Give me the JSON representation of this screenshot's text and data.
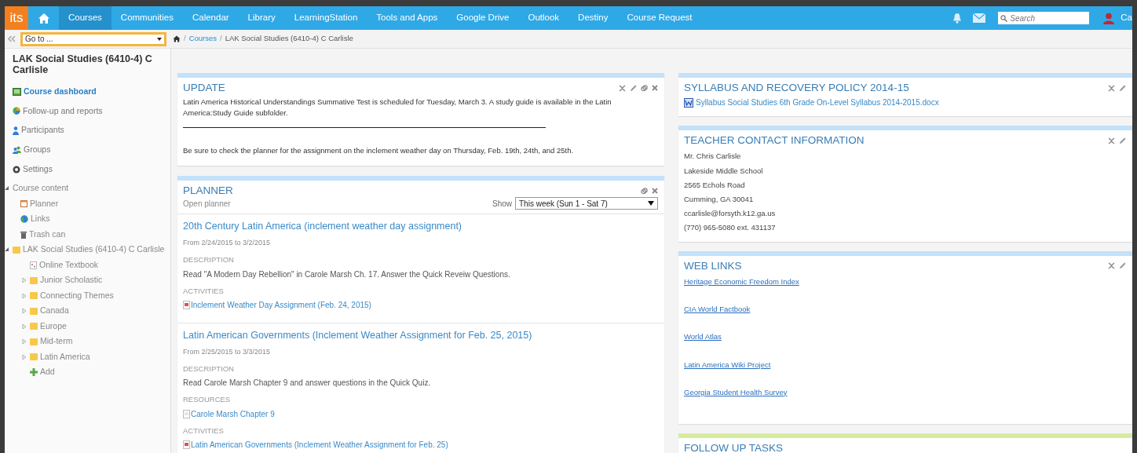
{
  "topnav": {
    "logo": "its",
    "items": [
      {
        "label": "Courses",
        "selected": true
      },
      {
        "label": "Communities",
        "selected": false
      },
      {
        "label": "Calendar",
        "selected": false
      },
      {
        "label": "Library",
        "selected": false
      },
      {
        "label": "LearningStation",
        "selected": false
      },
      {
        "label": "Tools and Apps",
        "selected": false
      },
      {
        "label": "Google Drive",
        "selected": false
      },
      {
        "label": "Outlook",
        "selected": false
      },
      {
        "label": "Destiny",
        "selected": false
      },
      {
        "label": "Course Request",
        "selected": false
      }
    ],
    "search": {
      "placeholder": "Search"
    },
    "user": "Ca"
  },
  "goto": {
    "placeholder": "Go to ..."
  },
  "breadcrumb": {
    "separator": "/",
    "items": [
      "Courses",
      "LAK Social Studies (6410-4) C Carlisle"
    ]
  },
  "sidebar": {
    "title": "LAK Social Studies (6410-4) C Carlisle",
    "nav": [
      {
        "label": "Course dashboard",
        "kind": "dashboard",
        "selected": true
      },
      {
        "label": "Follow-up and reports",
        "kind": "reports",
        "selected": false
      },
      {
        "label": "Participants",
        "kind": "participants",
        "selected": false
      },
      {
        "label": "Groups",
        "kind": "groups",
        "selected": false
      },
      {
        "label": "Settings",
        "kind": "settings",
        "selected": false
      }
    ],
    "tree": [
      {
        "label": "Course content",
        "kind": "section",
        "expanded": true,
        "children": [
          {
            "label": "Planner",
            "kind": "planner"
          },
          {
            "label": "Links",
            "kind": "links"
          },
          {
            "label": "Trash can",
            "kind": "trash"
          }
        ]
      },
      {
        "label": "LAK Social Studies (6410-4) C Carlisle",
        "kind": "folder",
        "expanded": true,
        "children": [
          {
            "label": "Online Textbook",
            "kind": "file"
          },
          {
            "label": "Junior Scholastic",
            "kind": "folder",
            "expanded": false
          },
          {
            "label": "Connecting Themes",
            "kind": "folder",
            "expanded": false
          },
          {
            "label": "Canada",
            "kind": "folder",
            "expanded": false
          },
          {
            "label": "Europe",
            "kind": "folder",
            "expanded": false
          },
          {
            "label": "Mid-term",
            "kind": "folder",
            "expanded": false
          },
          {
            "label": "Latin America",
            "kind": "folder",
            "expanded": false
          },
          {
            "label": "Add",
            "kind": "add"
          }
        ]
      }
    ]
  },
  "update": {
    "title": "UPDATE",
    "paragraphs": [
      "Latin America Historical Understandings Summative Test is scheduled for Tuesday, March 3. A study guide is available in the Latin America:Study Guide subfolder.",
      "Be sure to check the planner for the assignment on the inclement weather day on Thursday, Feb. 19th, 24th, and 25th."
    ]
  },
  "planner": {
    "title": "PLANNER",
    "open_link": "Open planner",
    "show_label": "Show",
    "show_value": "This week (Sun 1 - Sat 7)",
    "entries": [
      {
        "title": "20th Century Latin America (inclement weather day assignment)",
        "dates": "From 2/24/2015 to 3/2/2015",
        "sections": [
          {
            "heading": "DESCRIPTION",
            "kind": "text",
            "text": "Read \"A Modern Day Rebellion\" in Carole Marsh Ch. 17. Answer the Quick Reveiw Questions."
          },
          {
            "heading": "ACTIVITIES",
            "kind": "activity",
            "text": "Inclement Weather Day Assignment (Feb. 24, 2015)"
          }
        ]
      },
      {
        "title": "Latin American Governments (Inclement Weather Assignment for Feb. 25, 2015)",
        "dates": "From 2/25/2015 to 3/3/2015",
        "sections": [
          {
            "heading": "DESCRIPTION",
            "kind": "text",
            "text": "Read Carole Marsh Chapter 9 and answer questions in the Quick Quiz."
          },
          {
            "heading": "RESOURCES",
            "kind": "resource",
            "text": "Carole Marsh Chapter 9"
          },
          {
            "heading": "ACTIVITIES",
            "kind": "activity",
            "text": "Latin American Governments (Inclement Weather Assignment for Feb. 25)"
          }
        ]
      }
    ]
  },
  "syllabus": {
    "title": "SYLLABUS AND RECOVERY POLICY 2014-15",
    "file": "Syllabus Social Studies 6th Grade On-Level Syllabus 2014-2015.docx"
  },
  "contact": {
    "title": "TEACHER CONTACT INFORMATION",
    "lines": [
      "Mr. Chris Carlisle",
      "Lakeside Middle School",
      "2565 Echols Road",
      "Cumming, GA 30041",
      "ccarlisle@forsyth.k12.ga.us",
      "(770) 965-5080 ext. 431137"
    ]
  },
  "web_links": {
    "title": "WEB LINKS",
    "links": [
      "Heritage Economic Freedom Index",
      "CIA World Factbook",
      "World Atlas",
      "Latin America Wiki Project",
      "Georgia Student Health Survey"
    ]
  },
  "follow_up": {
    "title": "FOLLOW UP TASKS"
  }
}
